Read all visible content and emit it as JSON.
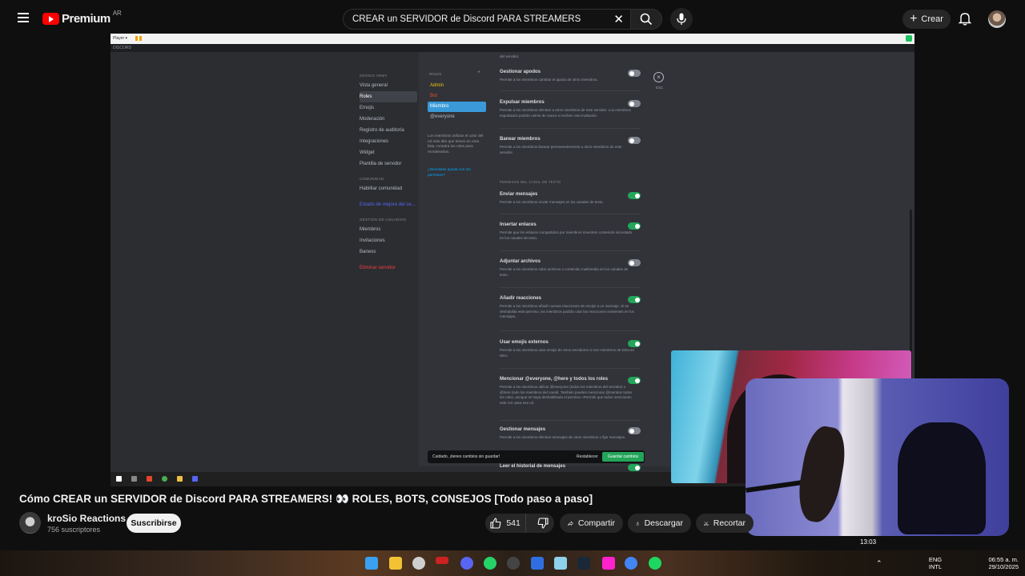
{
  "header": {
    "brand": "Premium",
    "region": "AR",
    "search_value": "CREAR un SERVIDOR de Discord PARA STREAMERS",
    "create_label": "Crear"
  },
  "player": {
    "bar_label": "Player ▾",
    "window_title": "DISCORD"
  },
  "discord": {
    "sidebar": {
      "server_heading": "KROSIO ARMY",
      "items": [
        "Vista general",
        "Roles",
        "Emojis",
        "Moderación",
        "Registro de auditoría",
        "Integraciones",
        "Widget",
        "Plantilla de servidor"
      ],
      "community_heading": "COMUNIDAD",
      "community_items": [
        "Habilitar comunidad"
      ],
      "boost_item": "Estado de mejora del se...",
      "users_heading": "GESTIÓN DE USUARIOS",
      "users_items": [
        "Miembros",
        "Invitaciones",
        "Baneos"
      ],
      "delete_item": "Eliminar servidor"
    },
    "roles": {
      "heading": "ROLES",
      "plus": "+",
      "list": [
        "Admin",
        "Bot",
        "Miembro",
        "@everyone"
      ],
      "note": "Los miembros utilizan el color del rol más alto que tienen en esta lista. Arrastra los roles para reordenarlos.",
      "help_link": "¿Necesitas ayuda con los permisos?"
    },
    "permissions": [
      {
        "title": "Gestionar apodos",
        "desc": "Permite a los miembros cambiar el apodo de otros miembros.",
        "on": false
      },
      {
        "title": "Expulsar miembros",
        "desc": "Permite a los miembros eliminar a otros miembros de este servidor. Los miembros expulsados podrán unirse de nuevo si reciben otra invitación.",
        "on": false
      },
      {
        "title": "Banear miembros",
        "desc": "Permite a los miembros banear permanentemente a otros miembros de este servidor.",
        "on": false
      },
      {
        "title": "Enviar mensajes",
        "desc": "Permite a los miembros enviar mensajes en los canales de texto.",
        "on": true
      },
      {
        "title": "Insertar enlaces",
        "desc": "Permite que los enlaces compartidos por miembros muestren contenido incrustado en los canales de texto.",
        "on": true
      },
      {
        "title": "Adjuntar archivos",
        "desc": "Permite a los miembros subir archivos o contenido multimedia en los canales de texto.",
        "on": false
      },
      {
        "title": "Añadir reacciones",
        "desc": "Permite a los miembros añadir nuevas reacciones de emojis a un mensaje. Si se deshabilita este permiso, los miembros podrán usar las reacciones existentes en los mensajes.",
        "on": true
      },
      {
        "title": "Usar emojis externos",
        "desc": "Permite a los miembros usar emojis de otros servidores si son miembros de Discord Nitro.",
        "on": true
      },
      {
        "title": "Mencionar @everyone, @here y todos los roles",
        "desc": "Permite a los miembros utilizar @everyone (todos los miembros del servidor) o @here (solo los miembros del canal). También pueden mencionar @mention todos los roles, aunque se haya deshabilitado el permiso «Permitir que todos mencionen este rol» para ese rol.",
        "on": true
      },
      {
        "title": "Gestionar mensajes",
        "desc": "Permite a los miembros eliminar mensajes de otros miembros o fijar mensajes.",
        "on": false
      },
      {
        "title": "Leer el historial de mensajes",
        "desc": "",
        "on": true
      }
    ],
    "category_heading": "PERMISOS DEL CANAL DE TEXTO",
    "top_cut_text": "del servidor.",
    "esc_label": "ESC",
    "unsaved": {
      "message": "Cuidado, ¡tienes cambios sin guardar!",
      "reset": "Restablecer",
      "save": "Guardar cambios"
    }
  },
  "video": {
    "title": "Cómo CREAR un SERVIDOR de Discord PARA STREAMERS! 👀 ROLES, BOTS, CONSEJOS [Todo paso a paso]",
    "channel": "kroSio  Reactions",
    "subscribers": "756 suscriptores",
    "subscribe": "Suscribirse",
    "likes": "541",
    "share": "Compartir",
    "download": "Descargar",
    "clip": "Recortar",
    "overlay_time": "13:03"
  },
  "taskbar": {
    "lang": "ENG",
    "layout": "INTL",
    "time": "06:55 a. m.",
    "date": "29/10/2025"
  }
}
